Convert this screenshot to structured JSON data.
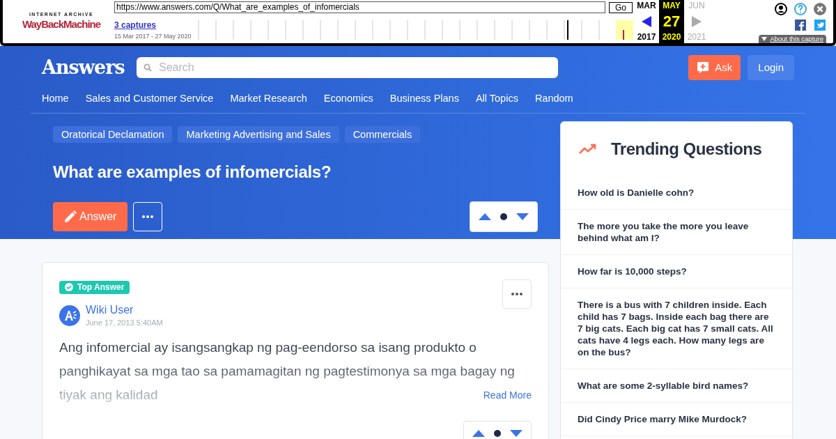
{
  "wayback": {
    "logo_top": "INTERNET ARCHIVE",
    "logo_main": "WayBackMachine",
    "url": "https://www.answers.com/Q/What_are_examples_of_infomercials",
    "go": "Go",
    "captures": "3 captures",
    "range": "15 Mar 2017 - 27 May 2020",
    "months": [
      {
        "month": "MAR",
        "year": "2017",
        "selected": false,
        "enabled": true
      },
      {
        "month": "MAY",
        "day": "27",
        "year": "2020",
        "selected": true,
        "enabled": true
      },
      {
        "month": "JUN",
        "year": "2021",
        "selected": false,
        "enabled": false
      }
    ],
    "about": "About this capture"
  },
  "header": {
    "logo": "Answers",
    "search_placeholder": "Search",
    "ask": "Ask",
    "login": "Login",
    "nav": [
      "Home",
      "Sales and Customer Service",
      "Market Research",
      "Economics",
      "Business Plans",
      "All Topics",
      "Random"
    ]
  },
  "question": {
    "tags": [
      "Oratorical Declamation",
      "Marketing Advertising and Sales",
      "Commercials"
    ],
    "title": "What are examples of infomercials?",
    "answer_button": "Answer"
  },
  "answer": {
    "badge": "Top Answer",
    "author": "Wiki User",
    "date": "June 17, 2013 5:40AM",
    "text": "Ang infomercial ay isangsangkap ng pag-eendorso sa isang produkto o panghikayat sa mga tao sa pamamagitan ng pagtestimonya sa mga bagay ng tiyak ang kalidad",
    "read_more": "Read More"
  },
  "trending": {
    "title": "Trending Questions",
    "items": [
      "How old is Danielle cohn?",
      "The more you take the more you leave behind what am I?",
      "How far is 10,000 steps?",
      "There is a bus with 7 children inside. Each child has 7 bags. Inside each bag there are 7 big cats. Each big cat has 7 small cats. All cats have 4 legs each. How many legs are on the bus?",
      "What are some 2-syllable bird names?",
      "Did Cindy Price marry Mike Murdock?"
    ]
  }
}
